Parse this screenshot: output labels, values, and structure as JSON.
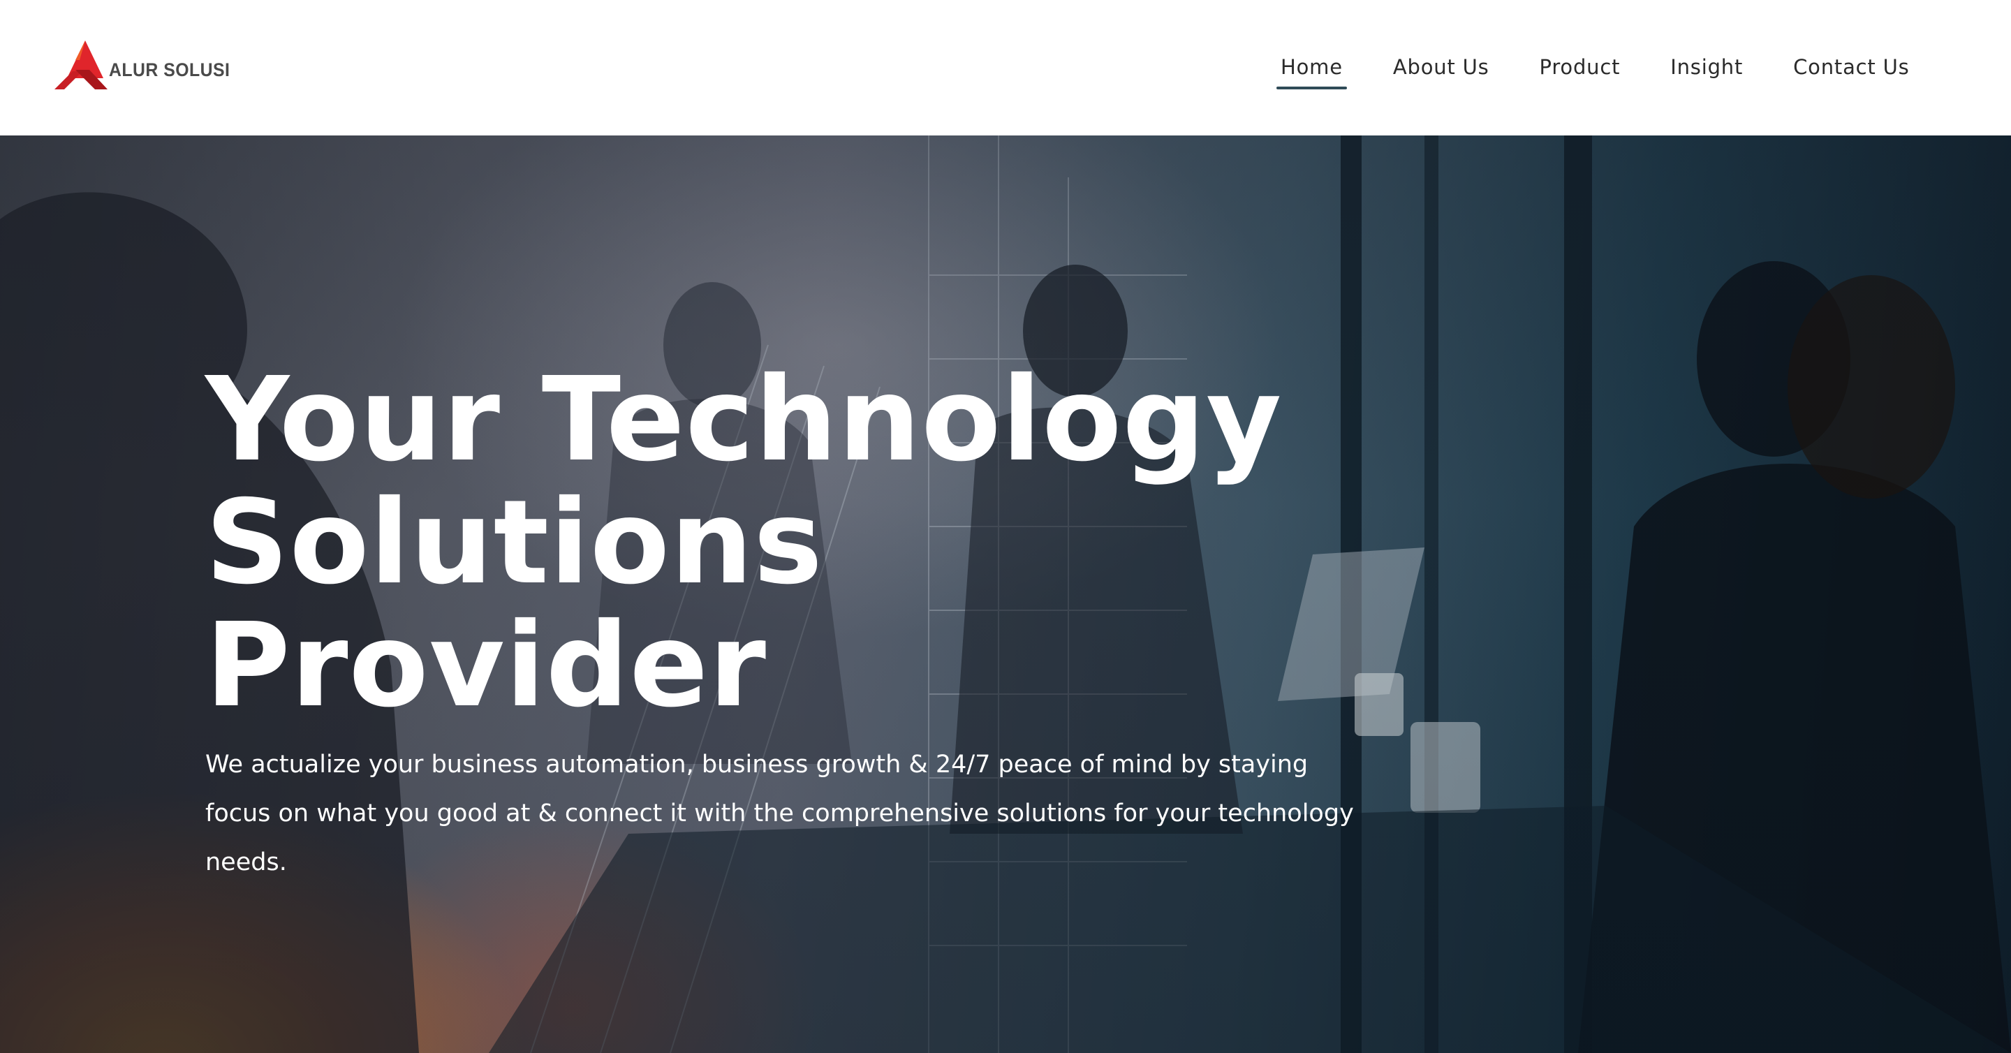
{
  "brand": {
    "name": "ALUR SOLUSI",
    "logo_icon": "red-triangle-x-logo",
    "colors": {
      "logo_red": "#e0252b",
      "logo_dark_red": "#a8161b",
      "nav_underline": "#2f4b57"
    }
  },
  "nav": {
    "items": [
      {
        "label": "Home",
        "active": true
      },
      {
        "label": "About Us",
        "active": false
      },
      {
        "label": "Product",
        "active": false
      },
      {
        "label": "Insight",
        "active": false
      },
      {
        "label": "Contact Us",
        "active": false
      }
    ]
  },
  "hero": {
    "title_line1": "Your Technology",
    "title_line2": "Solutions Provider",
    "subtitle": "We actualize your business automation, business growth & 24/7 peace of mind by staying focus on what you good at & connect it with the comprehensive solutions for your technology needs.",
    "background": "business-meeting-double-exposure-photo"
  }
}
